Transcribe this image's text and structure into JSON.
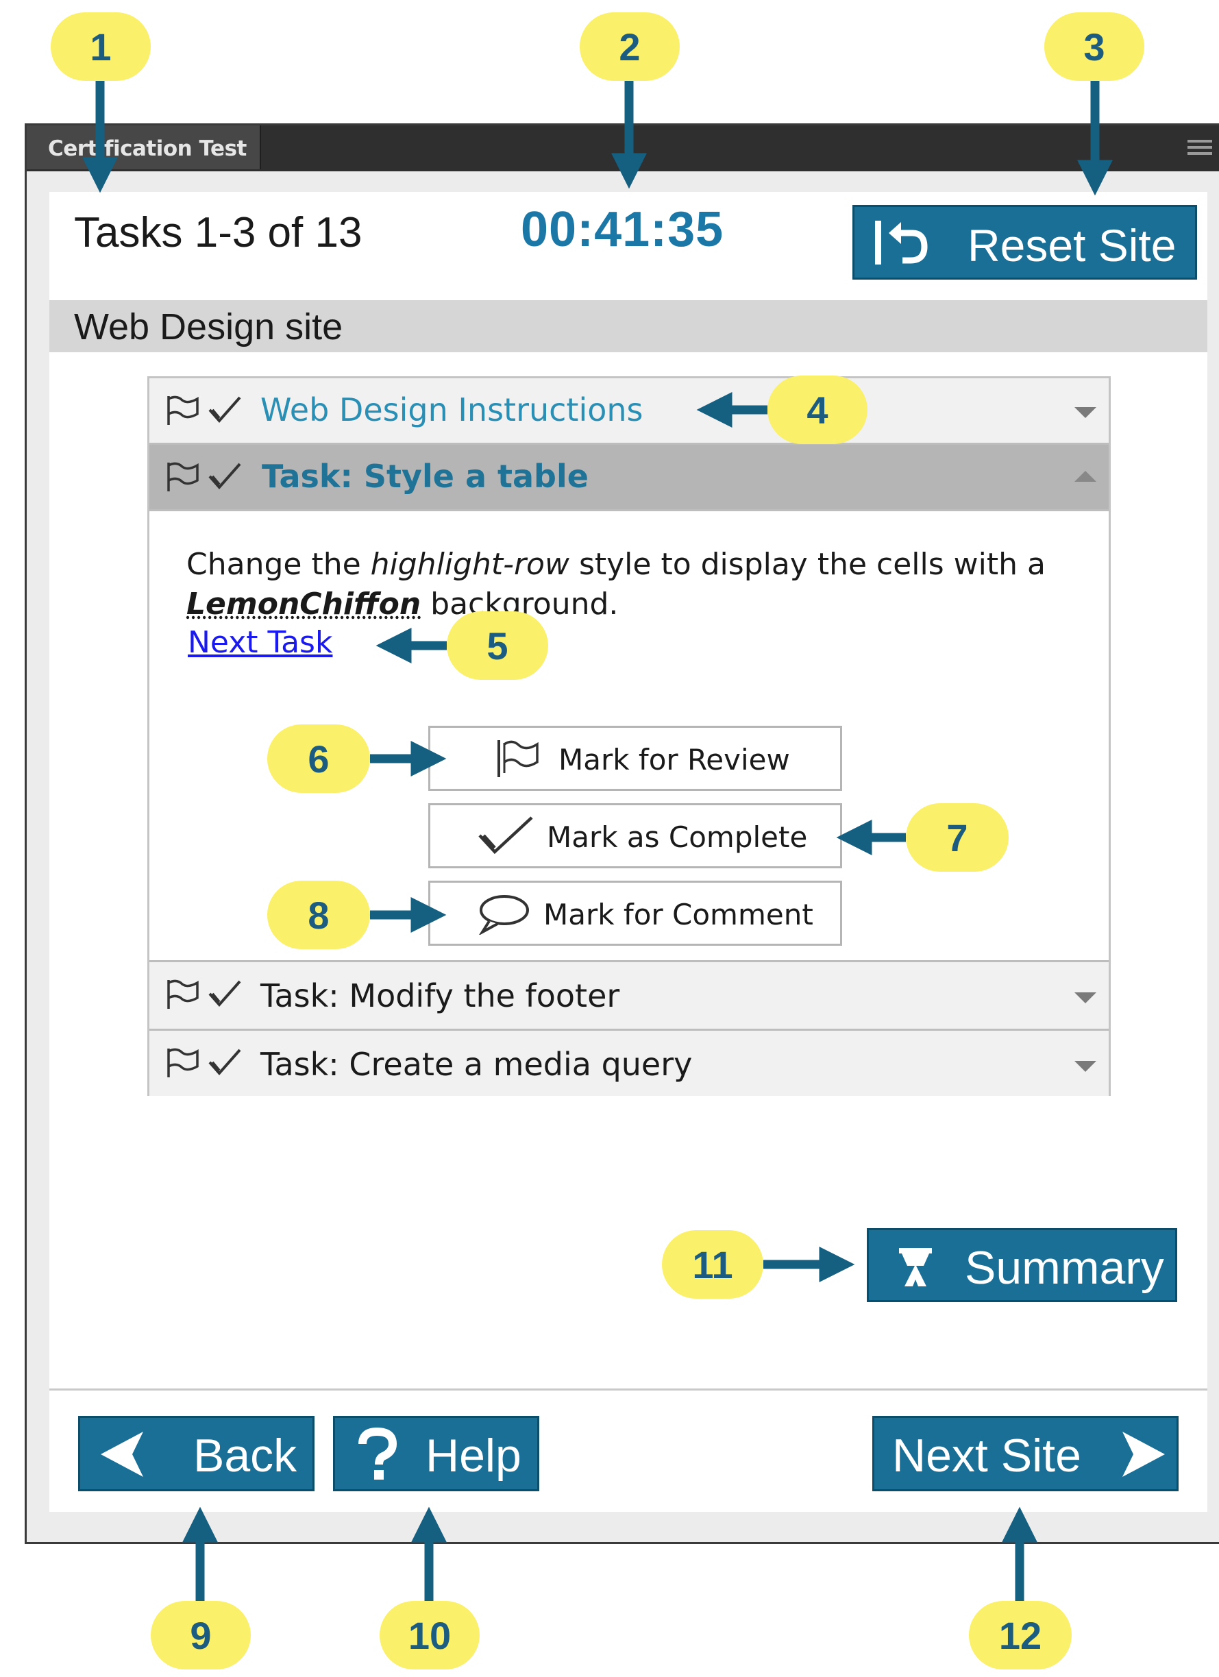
{
  "window": {
    "title": "Certification Test"
  },
  "header": {
    "tasks_count": "Tasks 1-3 of 13",
    "timer": "00:41:35",
    "reset_label": "Reset Site"
  },
  "site": {
    "name": "Web Design site"
  },
  "accordion": {
    "instructions_label": "Web Design Instructions",
    "active_task": {
      "label": "Task: Style a table",
      "desc_before": "Change the ",
      "desc_italic": "highlight-row",
      "desc_middle": " style to display the cells with a ",
      "desc_bold": "LemonChiffon",
      "desc_after": " background.",
      "next_task_link": "Next Task",
      "mark_review_label": "Mark for Review",
      "mark_complete_label": "Mark as Complete",
      "mark_comment_label": "Mark for Comment"
    },
    "other_tasks": [
      {
        "label": "Task: Modify the footer"
      },
      {
        "label": "Task: Create a media query"
      }
    ]
  },
  "footer": {
    "summary_label": "Summary",
    "back_label": "Back",
    "help_label": "Help",
    "next_site_label": "Next Site"
  },
  "callouts": [
    "1",
    "2",
    "3",
    "4",
    "5",
    "6",
    "7",
    "8",
    "9",
    "10",
    "11",
    "12"
  ],
  "colors": {
    "accent": "#1a6f96",
    "callout": "#fbf06a",
    "callout_text": "#1c5c80",
    "timer": "#1b77a6",
    "link": "#1a1aee"
  }
}
